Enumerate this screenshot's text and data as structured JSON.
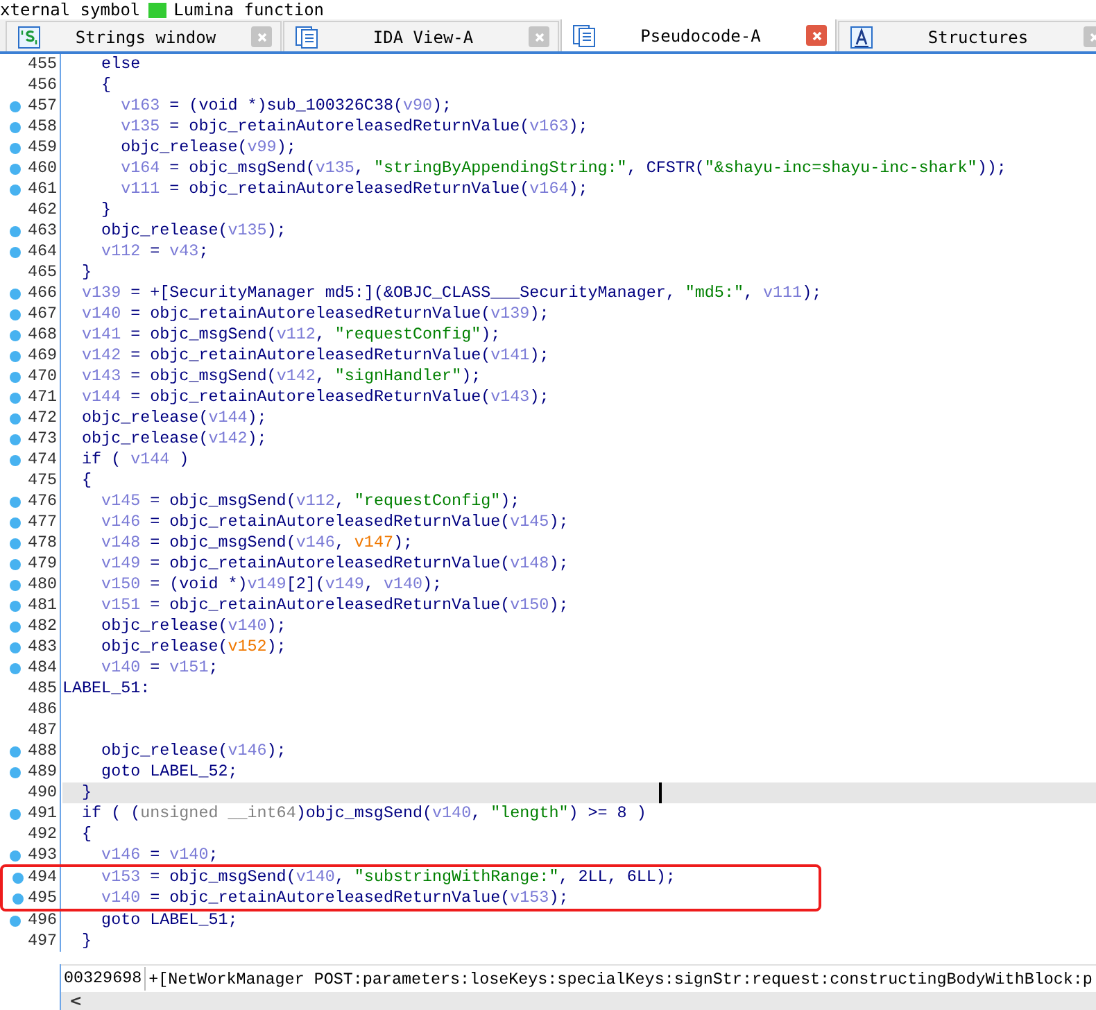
{
  "legend": [
    {
      "label": "xternal symbol"
    },
    {
      "label": "Lumina function",
      "color": "#33cc33"
    }
  ],
  "tabs": [
    {
      "label": "Strings window",
      "kind": "strings",
      "selected": false
    },
    {
      "label": "IDA View-A",
      "kind": "listing",
      "selected": false
    },
    {
      "label": "Pseudocode-A",
      "kind": "listing",
      "selected": true
    },
    {
      "label": "Structures",
      "kind": "struct",
      "selected": false
    }
  ],
  "lines": [
    {
      "number": "455",
      "dot": false,
      "selected": false,
      "boxed": false,
      "code": [
        {
          "kind": "code",
          "text": "    else"
        }
      ]
    },
    {
      "number": "456",
      "dot": false,
      "selected": false,
      "boxed": false,
      "code": [
        {
          "kind": "code",
          "text": "    {"
        }
      ]
    },
    {
      "number": "457",
      "dot": true,
      "selected": false,
      "boxed": false,
      "code": [
        {
          "kind": "var",
          "text": "      v163"
        },
        {
          "kind": "code",
          "text": " = (void *)sub_100326C38("
        },
        {
          "kind": "var",
          "text": "v90"
        },
        {
          "kind": "code",
          "text": ");"
        }
      ]
    },
    {
      "number": "458",
      "dot": true,
      "selected": false,
      "boxed": false,
      "code": [
        {
          "kind": "var",
          "text": "      v135"
        },
        {
          "kind": "code",
          "text": " = objc_retainAutoreleasedReturnValue("
        },
        {
          "kind": "var",
          "text": "v163"
        },
        {
          "kind": "code",
          "text": ");"
        }
      ]
    },
    {
      "number": "459",
      "dot": true,
      "selected": false,
      "boxed": false,
      "code": [
        {
          "kind": "code",
          "text": "      objc_release("
        },
        {
          "kind": "var",
          "text": "v99"
        },
        {
          "kind": "code",
          "text": ");"
        }
      ]
    },
    {
      "number": "460",
      "dot": true,
      "selected": false,
      "boxed": false,
      "code": [
        {
          "kind": "var",
          "text": "      v164"
        },
        {
          "kind": "code",
          "text": " = objc_msgSend("
        },
        {
          "kind": "var",
          "text": "v135"
        },
        {
          "kind": "code",
          "text": ", "
        },
        {
          "kind": "string",
          "text": "\"stringByAppendingString:\""
        },
        {
          "kind": "code",
          "text": ", CFSTR("
        },
        {
          "kind": "string",
          "text": "\"&shayu-inc=shayu-inc-shark\""
        },
        {
          "kind": "code",
          "text": "));"
        }
      ]
    },
    {
      "number": "461",
      "dot": true,
      "selected": false,
      "boxed": false,
      "code": [
        {
          "kind": "var",
          "text": "      v111"
        },
        {
          "kind": "code",
          "text": " = objc_retainAutoreleasedReturnValue("
        },
        {
          "kind": "var",
          "text": "v164"
        },
        {
          "kind": "code",
          "text": ");"
        }
      ]
    },
    {
      "number": "462",
      "dot": false,
      "selected": false,
      "boxed": false,
      "code": [
        {
          "kind": "code",
          "text": "    }"
        }
      ]
    },
    {
      "number": "463",
      "dot": true,
      "selected": false,
      "boxed": false,
      "code": [
        {
          "kind": "code",
          "text": "    objc_release("
        },
        {
          "kind": "var",
          "text": "v135"
        },
        {
          "kind": "code",
          "text": ");"
        }
      ]
    },
    {
      "number": "464",
      "dot": true,
      "selected": false,
      "boxed": false,
      "code": [
        {
          "kind": "var",
          "text": "    v112"
        },
        {
          "kind": "code",
          "text": " = "
        },
        {
          "kind": "var",
          "text": "v43"
        },
        {
          "kind": "code",
          "text": ";"
        }
      ]
    },
    {
      "number": "465",
      "dot": false,
      "selected": false,
      "boxed": false,
      "code": [
        {
          "kind": "code",
          "text": "  }"
        }
      ]
    },
    {
      "number": "466",
      "dot": true,
      "selected": false,
      "boxed": false,
      "code": [
        {
          "kind": "var",
          "text": "  v139"
        },
        {
          "kind": "code",
          "text": " = +[SecurityManager md5:](&OBJC_CLASS___SecurityManager, "
        },
        {
          "kind": "string",
          "text": "\"md5:\""
        },
        {
          "kind": "code",
          "text": ", "
        },
        {
          "kind": "var",
          "text": "v111"
        },
        {
          "kind": "code",
          "text": ");"
        }
      ]
    },
    {
      "number": "467",
      "dot": true,
      "selected": false,
      "boxed": false,
      "code": [
        {
          "kind": "var",
          "text": "  v140"
        },
        {
          "kind": "code",
          "text": " = objc_retainAutoreleasedReturnValue("
        },
        {
          "kind": "var",
          "text": "v139"
        },
        {
          "kind": "code",
          "text": ");"
        }
      ]
    },
    {
      "number": "468",
      "dot": true,
      "selected": false,
      "boxed": false,
      "code": [
        {
          "kind": "var",
          "text": "  v141"
        },
        {
          "kind": "code",
          "text": " = objc_msgSend("
        },
        {
          "kind": "var",
          "text": "v112"
        },
        {
          "kind": "code",
          "text": ", "
        },
        {
          "kind": "string",
          "text": "\"requestConfig\""
        },
        {
          "kind": "code",
          "text": ");"
        }
      ]
    },
    {
      "number": "469",
      "dot": true,
      "selected": false,
      "boxed": false,
      "code": [
        {
          "kind": "var",
          "text": "  v142"
        },
        {
          "kind": "code",
          "text": " = objc_retainAutoreleasedReturnValue("
        },
        {
          "kind": "var",
          "text": "v141"
        },
        {
          "kind": "code",
          "text": ");"
        }
      ]
    },
    {
      "number": "470",
      "dot": true,
      "selected": false,
      "boxed": false,
      "code": [
        {
          "kind": "var",
          "text": "  v143"
        },
        {
          "kind": "code",
          "text": " = objc_msgSend("
        },
        {
          "kind": "var",
          "text": "v142"
        },
        {
          "kind": "code",
          "text": ", "
        },
        {
          "kind": "string",
          "text": "\"signHandler\""
        },
        {
          "kind": "code",
          "text": ");"
        }
      ]
    },
    {
      "number": "471",
      "dot": true,
      "selected": false,
      "boxed": false,
      "code": [
        {
          "kind": "var",
          "text": "  v144"
        },
        {
          "kind": "code",
          "text": " = objc_retainAutoreleasedReturnValue("
        },
        {
          "kind": "var",
          "text": "v143"
        },
        {
          "kind": "code",
          "text": ");"
        }
      ]
    },
    {
      "number": "472",
      "dot": true,
      "selected": false,
      "boxed": false,
      "code": [
        {
          "kind": "code",
          "text": "  objc_release("
        },
        {
          "kind": "var",
          "text": "v144"
        },
        {
          "kind": "code",
          "text": ");"
        }
      ]
    },
    {
      "number": "473",
      "dot": true,
      "selected": false,
      "boxed": false,
      "code": [
        {
          "kind": "code",
          "text": "  objc_release("
        },
        {
          "kind": "var",
          "text": "v142"
        },
        {
          "kind": "code",
          "text": ");"
        }
      ]
    },
    {
      "number": "474",
      "dot": true,
      "selected": false,
      "boxed": false,
      "code": [
        {
          "kind": "code",
          "text": "  if ( "
        },
        {
          "kind": "var",
          "text": "v144"
        },
        {
          "kind": "code",
          "text": " )"
        }
      ]
    },
    {
      "number": "475",
      "dot": false,
      "selected": false,
      "boxed": false,
      "code": [
        {
          "kind": "code",
          "text": "  {"
        }
      ]
    },
    {
      "number": "476",
      "dot": true,
      "selected": false,
      "boxed": false,
      "code": [
        {
          "kind": "var",
          "text": "    v145"
        },
        {
          "kind": "code",
          "text": " = objc_msgSend("
        },
        {
          "kind": "var",
          "text": "v112"
        },
        {
          "kind": "code",
          "text": ", "
        },
        {
          "kind": "string",
          "text": "\"requestConfig\""
        },
        {
          "kind": "code",
          "text": ");"
        }
      ]
    },
    {
      "number": "477",
      "dot": true,
      "selected": false,
      "boxed": false,
      "code": [
        {
          "kind": "var",
          "text": "    v146"
        },
        {
          "kind": "code",
          "text": " = objc_retainAutoreleasedReturnValue("
        },
        {
          "kind": "var",
          "text": "v145"
        },
        {
          "kind": "code",
          "text": ");"
        }
      ]
    },
    {
      "number": "478",
      "dot": true,
      "selected": false,
      "boxed": false,
      "code": [
        {
          "kind": "var",
          "text": "    v148"
        },
        {
          "kind": "code",
          "text": " = objc_msgSend("
        },
        {
          "kind": "var",
          "text": "v146"
        },
        {
          "kind": "code",
          "text": ", "
        },
        {
          "kind": "unknown",
          "text": "v147"
        },
        {
          "kind": "code",
          "text": ");"
        }
      ]
    },
    {
      "number": "479",
      "dot": true,
      "selected": false,
      "boxed": false,
      "code": [
        {
          "kind": "var",
          "text": "    v149"
        },
        {
          "kind": "code",
          "text": " = objc_retainAutoreleasedReturnValue("
        },
        {
          "kind": "var",
          "text": "v148"
        },
        {
          "kind": "code",
          "text": ");"
        }
      ]
    },
    {
      "number": "480",
      "dot": true,
      "selected": false,
      "boxed": false,
      "code": [
        {
          "kind": "var",
          "text": "    v150"
        },
        {
          "kind": "code",
          "text": " = (void *)"
        },
        {
          "kind": "var",
          "text": "v149"
        },
        {
          "kind": "code",
          "text": "[2]("
        },
        {
          "kind": "var",
          "text": "v149"
        },
        {
          "kind": "code",
          "text": ", "
        },
        {
          "kind": "var",
          "text": "v140"
        },
        {
          "kind": "code",
          "text": ");"
        }
      ]
    },
    {
      "number": "481",
      "dot": true,
      "selected": false,
      "boxed": false,
      "code": [
        {
          "kind": "var",
          "text": "    v151"
        },
        {
          "kind": "code",
          "text": " = objc_retainAutoreleasedReturnValue("
        },
        {
          "kind": "var",
          "text": "v150"
        },
        {
          "kind": "code",
          "text": ");"
        }
      ]
    },
    {
      "number": "482",
      "dot": true,
      "selected": false,
      "boxed": false,
      "code": [
        {
          "kind": "code",
          "text": "    objc_release("
        },
        {
          "kind": "var",
          "text": "v140"
        },
        {
          "kind": "code",
          "text": ");"
        }
      ]
    },
    {
      "number": "483",
      "dot": true,
      "selected": false,
      "boxed": false,
      "code": [
        {
          "kind": "code",
          "text": "    objc_release("
        },
        {
          "kind": "unknown",
          "text": "v152"
        },
        {
          "kind": "code",
          "text": ");"
        }
      ]
    },
    {
      "number": "484",
      "dot": true,
      "selected": false,
      "boxed": false,
      "code": [
        {
          "kind": "var",
          "text": "    v140"
        },
        {
          "kind": "code",
          "text": " = "
        },
        {
          "kind": "var",
          "text": "v151"
        },
        {
          "kind": "code",
          "text": ";"
        }
      ]
    },
    {
      "number": "485",
      "dot": false,
      "selected": false,
      "boxed": false,
      "code": [
        {
          "kind": "code",
          "text": "LABEL_51:"
        }
      ]
    },
    {
      "number": "486",
      "dot": false,
      "selected": false,
      "boxed": false
    },
    {
      "number": "487",
      "dot": false,
      "selected": false,
      "boxed": false
    },
    {
      "number": "488",
      "dot": true,
      "selected": false,
      "boxed": false,
      "code": [
        {
          "kind": "code",
          "text": "    objc_release("
        },
        {
          "kind": "var",
          "text": "v146"
        },
        {
          "kind": "code",
          "text": ");"
        }
      ]
    },
    {
      "number": "489",
      "dot": true,
      "selected": false,
      "boxed": false,
      "code": [
        {
          "kind": "code",
          "text": "    goto LABEL_52;"
        }
      ]
    },
    {
      "number": "490",
      "dot": false,
      "selected": true,
      "boxed": false,
      "code": [
        {
          "kind": "code",
          "text": "  }"
        }
      ]
    },
    {
      "number": "491",
      "dot": true,
      "selected": false,
      "boxed": false,
      "code": [
        {
          "kind": "code",
          "text": "  if ( ("
        },
        {
          "kind": "type",
          "text": "unsigned __int64"
        },
        {
          "kind": "code",
          "text": ")objc_msgSend("
        },
        {
          "kind": "var",
          "text": "v140"
        },
        {
          "kind": "code",
          "text": ", "
        },
        {
          "kind": "string",
          "text": "\"length\""
        },
        {
          "kind": "code",
          "text": ") >= 8 )"
        }
      ]
    },
    {
      "number": "492",
      "dot": false,
      "selected": false,
      "boxed": false,
      "code": [
        {
          "kind": "code",
          "text": "  {"
        }
      ]
    },
    {
      "number": "493",
      "dot": true,
      "selected": false,
      "boxed": false,
      "code": [
        {
          "kind": "var",
          "text": "    v146"
        },
        {
          "kind": "code",
          "text": " = "
        },
        {
          "kind": "var",
          "text": "v140"
        },
        {
          "kind": "code",
          "text": ";"
        }
      ]
    },
    {
      "number": "494",
      "dot": true,
      "selected": false,
      "boxed": true,
      "code": [
        {
          "kind": "var",
          "text": "    v153"
        },
        {
          "kind": "code",
          "text": " = objc_msgSend("
        },
        {
          "kind": "var",
          "text": "v140"
        },
        {
          "kind": "code",
          "text": ", "
        },
        {
          "kind": "string",
          "text": "\"substringWithRange:\""
        },
        {
          "kind": "code",
          "text": ", 2LL, 6LL);"
        }
      ]
    },
    {
      "number": "495",
      "dot": true,
      "selected": false,
      "boxed": true,
      "code": [
        {
          "kind": "var",
          "text": "    v140"
        },
        {
          "kind": "code",
          "text": " = objc_retainAutoreleasedReturnValue("
        },
        {
          "kind": "var",
          "text": "v153"
        },
        {
          "kind": "code",
          "text": ");"
        }
      ]
    },
    {
      "number": "496",
      "dot": true,
      "selected": false,
      "boxed": false,
      "code": [
        {
          "kind": "code",
          "text": "    goto LABEL_51;"
        }
      ]
    },
    {
      "number": "497",
      "dot": false,
      "selected": false,
      "boxed": false,
      "code": [
        {
          "kind": "code",
          "text": "  }"
        }
      ]
    }
  ],
  "status": {
    "address": "00329698",
    "function": "+[NetWorkManager POST:parameters:loseKeys:specialKeys:signStr:request:constructingBodyWithBlock:p"
  },
  "scrollbar": {
    "left_arrow": "<"
  }
}
